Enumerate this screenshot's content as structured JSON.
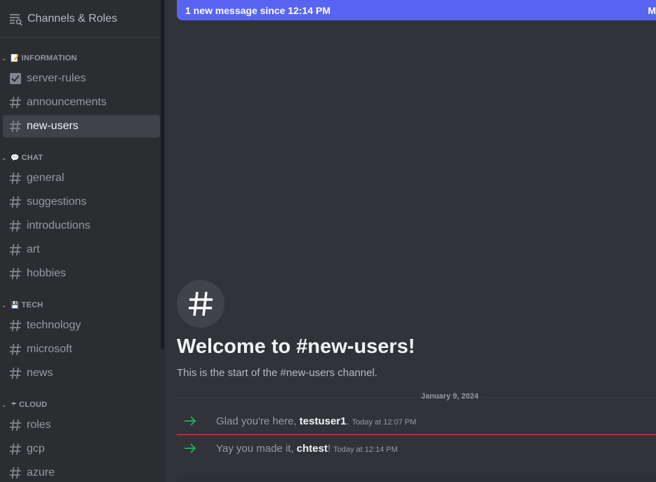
{
  "sidebar": {
    "header_label": "Channels & Roles",
    "categories": [
      {
        "emoji": "📝",
        "label": "INFORMATION"
      },
      {
        "emoji": "💬",
        "label": "CHAT"
      },
      {
        "emoji": "💾",
        "label": "TECH"
      },
      {
        "emoji": "☂",
        "label": "CLOUD"
      }
    ],
    "channels": [
      {
        "name": "server-rules",
        "icon": "rules-icon"
      },
      {
        "name": "announcements",
        "icon": "hash-icon"
      },
      {
        "name": "new-users",
        "icon": "hash-icon",
        "active": true
      },
      {
        "name": "general",
        "icon": "hash-icon"
      },
      {
        "name": "suggestions",
        "icon": "hash-icon"
      },
      {
        "name": "introductions",
        "icon": "hash-icon"
      },
      {
        "name": "art",
        "icon": "hash-icon"
      },
      {
        "name": "hobbies",
        "icon": "hash-icon"
      },
      {
        "name": "technology",
        "icon": "hash-icon"
      },
      {
        "name": "microsoft",
        "icon": "hash-icon"
      },
      {
        "name": "news",
        "icon": "hash-icon"
      },
      {
        "name": "roles",
        "icon": "hash-icon"
      },
      {
        "name": "gcp",
        "icon": "hash-icon"
      },
      {
        "name": "azure",
        "icon": "hash-icon"
      }
    ]
  },
  "banner": {
    "text": "1 new message since 12:14 PM",
    "right_text": "M"
  },
  "welcome": {
    "title": "Welcome to #new-users!",
    "subtitle": "This is the start of the #new-users channel."
  },
  "date_divider": "January 9, 2024",
  "messages": [
    {
      "prefix": "Glad you're here, ",
      "user": "testuser1",
      "suffix": ".",
      "time": "Today at 12:07 PM"
    },
    {
      "prefix": "Yay you made it, ",
      "user": "chtest",
      "suffix": "!",
      "time": "Today at 12:14 PM"
    }
  ],
  "colors": {
    "accent": "#5865f2",
    "join_arrow": "#23a55a",
    "new_message_line": "#f23f43"
  }
}
